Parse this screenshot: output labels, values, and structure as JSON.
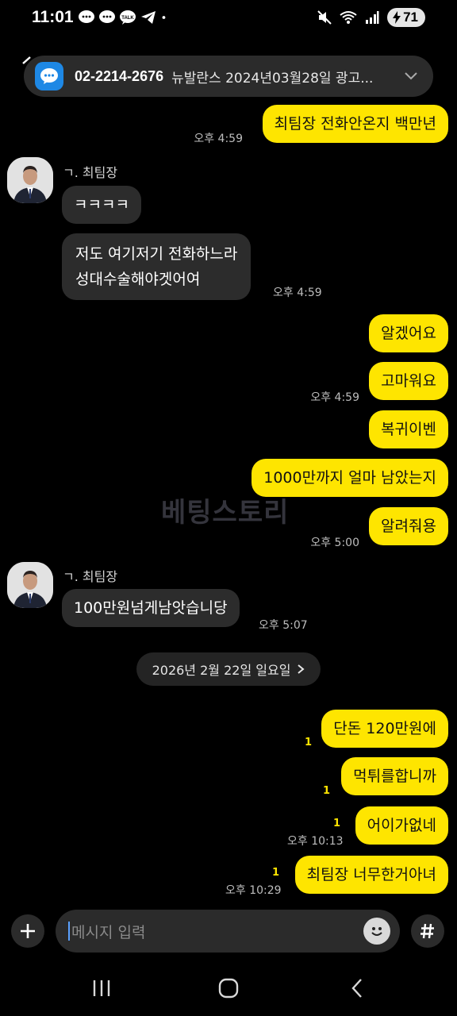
{
  "status_bar": {
    "time": "11:01",
    "app_icons": [
      "message-bubble-icon",
      "message-bubble-icon",
      "kakaotalk-icon",
      "telegram-icon",
      "dot-icon"
    ],
    "battery": "71"
  },
  "notification": {
    "number": "02-2214-2676",
    "text": "뉴발란스 2024년03월28일 광고..."
  },
  "messages": [
    {
      "id": "m1",
      "side": "me",
      "text": "최팀장 전화안온지 백만년",
      "time": "오후 4:59"
    },
    {
      "id": "s1",
      "sender": "ㄱ. 최팀장"
    },
    {
      "id": "m2",
      "side": "them",
      "text": "ㅋㅋㅋㅋ"
    },
    {
      "id": "m3",
      "side": "them",
      "lines": [
        "저도 여기저기 전화하느라",
        "성대수술해야겟어여"
      ],
      "time": "오후 4:59"
    },
    {
      "id": "m4",
      "side": "me",
      "text": "알겠어요"
    },
    {
      "id": "m5",
      "side": "me",
      "text": "고마워요",
      "time": "오후 4:59"
    },
    {
      "id": "m6",
      "side": "me",
      "text": "복귀이벤"
    },
    {
      "id": "m7",
      "side": "me",
      "text": "1000만까지 얼마 남았는지"
    },
    {
      "id": "m8",
      "side": "me",
      "text": "알려줘용",
      "time": "오후 5:00"
    },
    {
      "id": "s2",
      "sender": "ㄱ. 최팀장"
    },
    {
      "id": "m9",
      "side": "them",
      "text": "100만원넘게남앗습니당",
      "time": "오후 5:07"
    },
    {
      "id": "d1",
      "date": "2026년 2월 22일 일요일"
    },
    {
      "id": "m10",
      "side": "me",
      "text": "단돈 120만원에",
      "unread": "1"
    },
    {
      "id": "m11",
      "side": "me",
      "text": "먹튀를합니까",
      "unread": "1"
    },
    {
      "id": "m12",
      "side": "me",
      "text": "어이가없네",
      "unread": "1",
      "time": "오후 10:13"
    },
    {
      "id": "m13",
      "side": "me",
      "text": "최팀장 너무한거아녀",
      "unread": "1",
      "time": "오후 10:29"
    }
  ],
  "watermark": "베팅스토리",
  "input": {
    "placeholder": "메시지 입력"
  },
  "colors": {
    "my_bubble": "#fee500",
    "their_bubble": "#2c2c2c",
    "background": "#000000",
    "unread": "#fee500"
  }
}
